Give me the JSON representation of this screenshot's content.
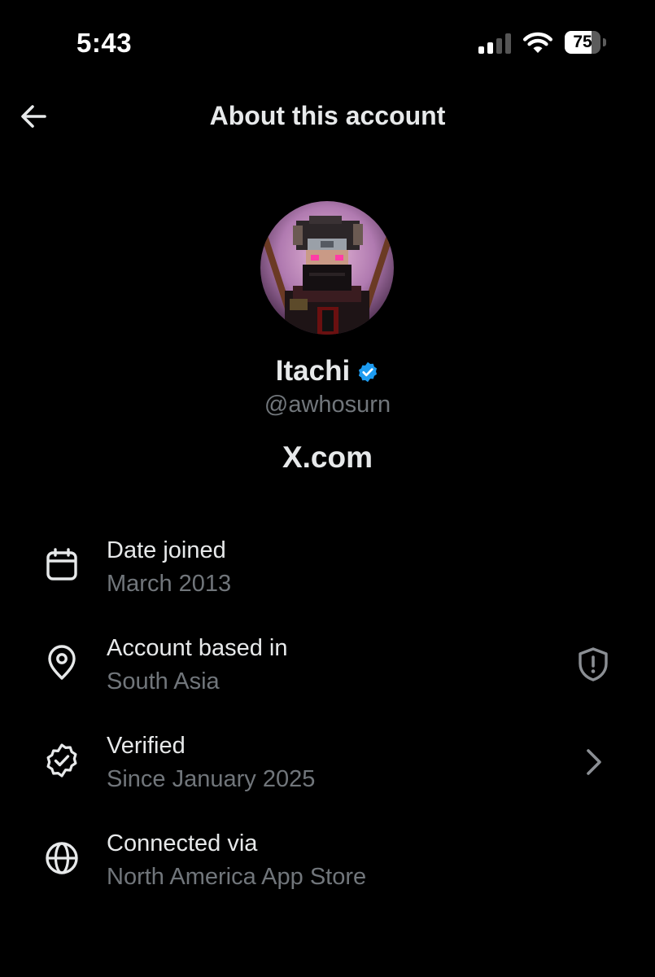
{
  "status_bar": {
    "time": "5:43",
    "battery_level": "75",
    "battery_fraction": 0.75
  },
  "header": {
    "title": "About this account",
    "back_icon": "arrow-left-icon"
  },
  "profile": {
    "display_name": "Itachi",
    "handle": "@awhosurn",
    "verified": true,
    "verified_color": "#1d9bf0",
    "platform": "X.com"
  },
  "rows": [
    {
      "icon": "calendar-icon",
      "label": "Date joined",
      "value": "March 2013"
    },
    {
      "icon": "location-pin-icon",
      "label": "Account based in",
      "value": "South Asia",
      "trailing_icon": "shield-alert-icon"
    },
    {
      "icon": "verified-check-icon",
      "label": "Verified",
      "value": "Since January 2025",
      "trailing_icon": "chevron-right-icon"
    },
    {
      "icon": "globe-icon",
      "label": "Connected via",
      "value": "North America App Store"
    }
  ],
  "colors": {
    "background": "#000000",
    "primary_text": "#e7e9ea",
    "secondary_text": "#71767b",
    "accent": "#1d9bf0"
  }
}
